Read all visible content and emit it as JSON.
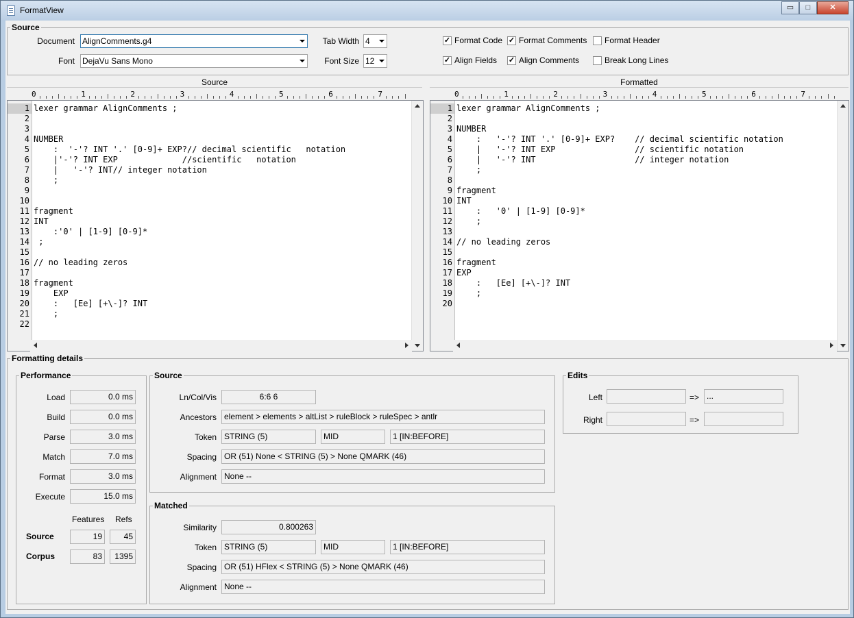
{
  "window": {
    "title": "FormatView",
    "min_label": "▭",
    "max_label": "□",
    "close_label": "✕"
  },
  "source_group": {
    "title": "Source",
    "document_label": "Document",
    "document_value": "AlignComments.g4",
    "font_label": "Font",
    "font_value": "DejaVu Sans Mono",
    "tab_width_label": "Tab Width",
    "tab_width_value": "4",
    "font_size_label": "Font Size",
    "font_size_value": "12",
    "options": [
      {
        "label": "Format Code",
        "checked": true
      },
      {
        "label": "Format Comments",
        "checked": true
      },
      {
        "label": "Format Header",
        "checked": false
      },
      {
        "label": "Align Fields",
        "checked": true
      },
      {
        "label": "Align Comments",
        "checked": true
      },
      {
        "label": "Break Long Lines",
        "checked": false
      }
    ]
  },
  "panes": {
    "source_title": "Source",
    "formatted_title": "Formatted",
    "ruler_digits": [
      "0",
      "1",
      "2",
      "3",
      "4",
      "5",
      "6",
      "7"
    ]
  },
  "source_code": [
    "lexer grammar AlignComments ;",
    "",
    "",
    "NUMBER",
    "    :  '-'? INT '.' [0-9]+ EXP?// decimal scientific   notation",
    "    |'-'? INT EXP             //scientific   notation",
    "    |   '-'? INT// integer notation",
    "    ;",
    "",
    "",
    "fragment",
    "INT",
    "    :'0' | [1-9] [0-9]*",
    " ;",
    "",
    "// no leading zeros",
    "",
    "fragment",
    "    EXP",
    "    :   [Ee] [+\\-]? INT",
    "    ;",
    ""
  ],
  "formatted_code": [
    "lexer grammar AlignComments ;",
    "",
    "NUMBER",
    "    :   '-'? INT '.' [0-9]+ EXP?    // decimal scientific notation",
    "    |   '-'? INT EXP                // scientific notation",
    "    |   '-'? INT                    // integer notation",
    "    ;",
    "",
    "fragment",
    "INT",
    "    :   '0' | [1-9] [0-9]*",
    "    ;",
    "",
    "// no leading zeros",
    "",
    "fragment",
    "EXP",
    "    :   [Ee] [+\\-]? INT",
    "    ;",
    ""
  ],
  "details": {
    "title": "Formatting details",
    "performance": {
      "title": "Performance",
      "rows": [
        {
          "label": "Load",
          "value": "0.0 ms"
        },
        {
          "label": "Build",
          "value": "0.0 ms"
        },
        {
          "label": "Parse",
          "value": "3.0 ms"
        },
        {
          "label": "Match",
          "value": "7.0 ms"
        },
        {
          "label": "Format",
          "value": "3.0 ms"
        },
        {
          "label": "Execute",
          "value": "15.0 ms"
        }
      ],
      "features_header": "Features",
      "refs_header": "Refs",
      "source_label": "Source",
      "source_features": "19",
      "source_refs": "45",
      "corpus_label": "Corpus",
      "corpus_features": "83",
      "corpus_refs": "1395"
    },
    "source": {
      "title": "Source",
      "lncol_label": "Ln/Col/Vis",
      "lncol_value": "6:6 6",
      "ancestors_label": "Ancestors",
      "ancestors_value": "element > elements > altList > ruleBlock > ruleSpec > antlr",
      "token_label": "Token",
      "token_value": "STRING (5)",
      "token_mid": "MID",
      "token_pos": "1 [IN:BEFORE]",
      "spacing_label": "Spacing",
      "spacing_value": "OR (51)  None  <  STRING (5)  >  None  QMARK (46)",
      "alignment_label": "Alignment",
      "alignment_value": "None --"
    },
    "matched": {
      "title": "Matched",
      "similarity_label": "Similarity",
      "similarity_value": "0.800263",
      "token_label": "Token",
      "token_value": "STRING (5)",
      "token_mid": "MID",
      "token_pos": "1 [IN:BEFORE]",
      "spacing_label": "Spacing",
      "spacing_value": "OR (51)  HFlex  <  STRING (5)  >  None  QMARK (46)",
      "alignment_label": "Alignment",
      "alignment_value": "None --"
    },
    "edits": {
      "title": "Edits",
      "left_label": "Left",
      "left_value": "",
      "left_arrow": "=>",
      "left_result": "...",
      "right_label": "Right",
      "right_value": "",
      "right_arrow": "=>",
      "right_result": ""
    }
  }
}
